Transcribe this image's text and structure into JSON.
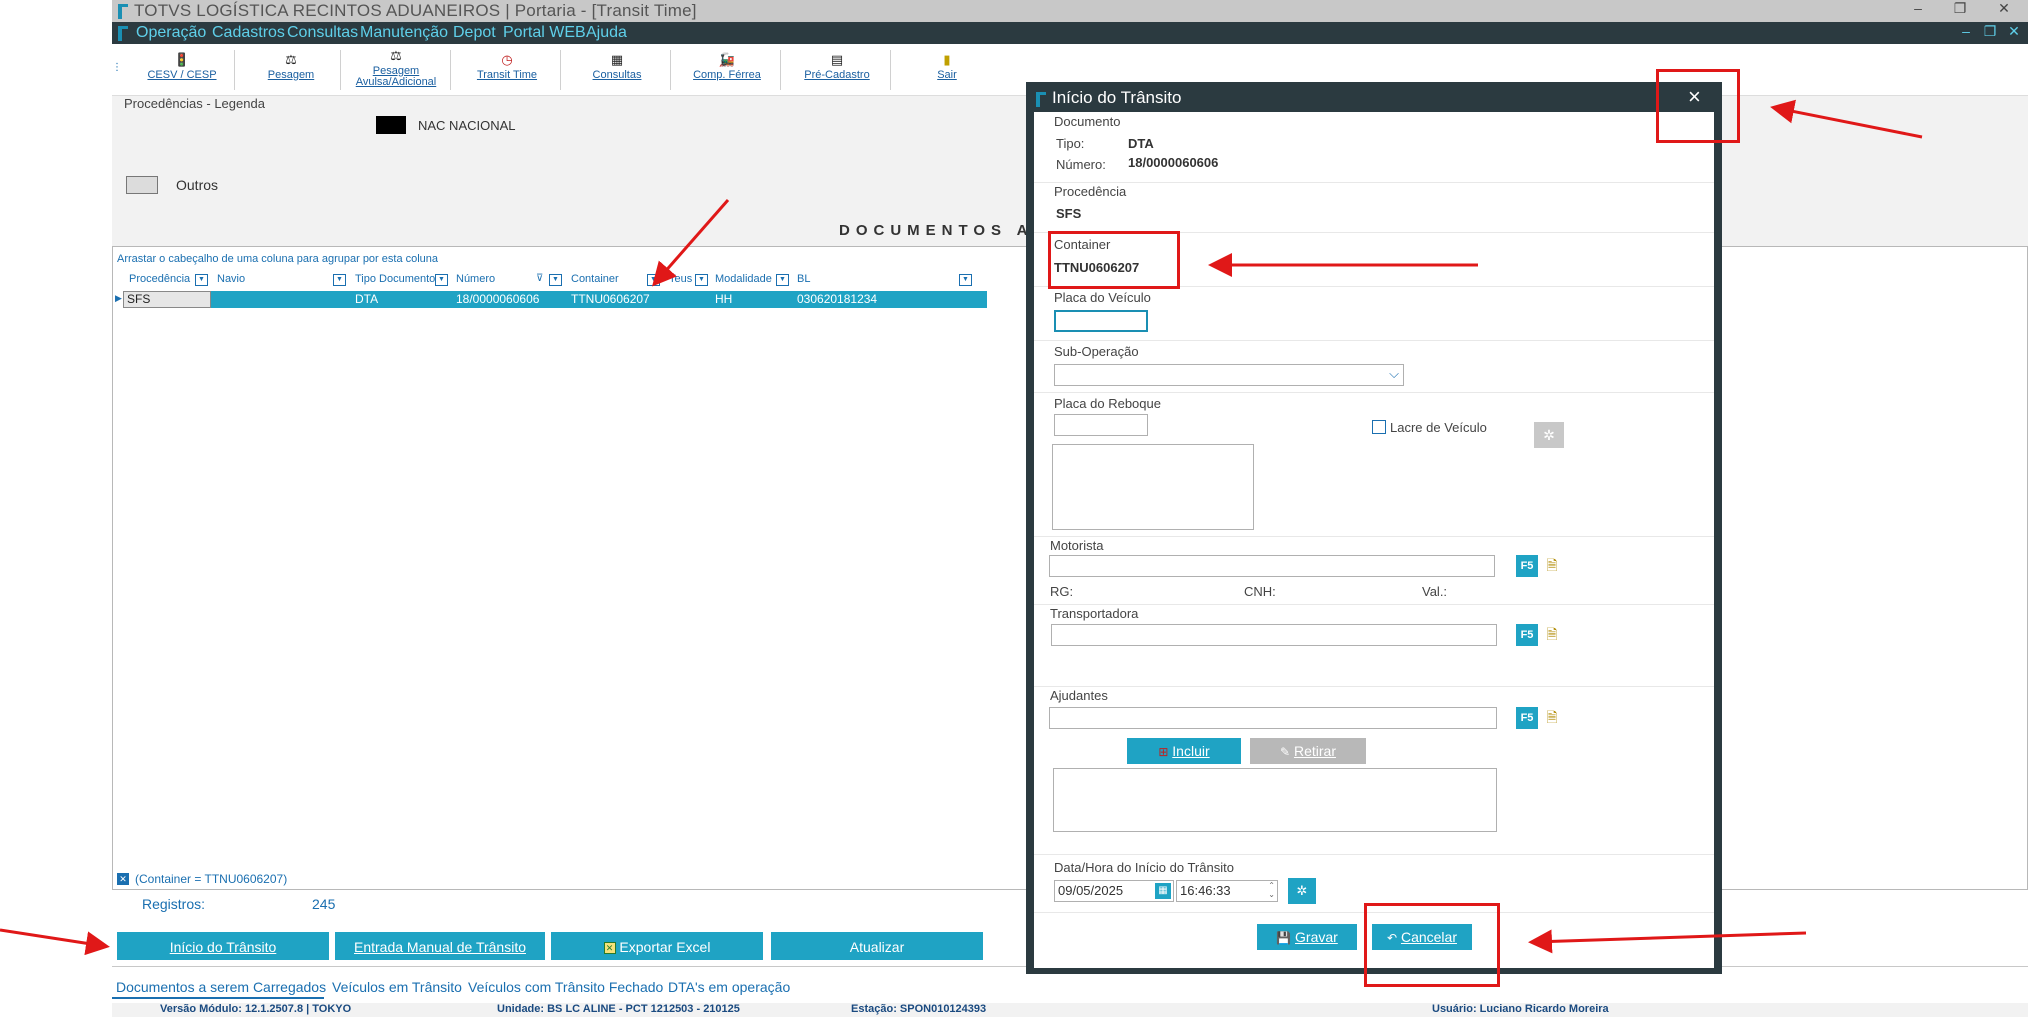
{
  "window": {
    "title": "TOTVS LOGÍSTICA RECINTOS ADUANEIROS | Portaria - [Transit Time]",
    "controls": [
      "–",
      "❐",
      "✕"
    ]
  },
  "menu": {
    "items": [
      "Operação",
      "Cadastros",
      "Consultas",
      "Manutenção",
      "Depot",
      "Portal WEB",
      "Ajuda"
    ],
    "controls": [
      "–",
      "❐",
      "✕"
    ]
  },
  "toolbar": {
    "items": [
      {
        "label": "CESV / CESP",
        "icon": "traffic-light-icon"
      },
      {
        "label": "Pesagem",
        "icon": "scale-icon"
      },
      {
        "label": "Pesagem Avulsa/Adicional",
        "icon": "scale-icon"
      },
      {
        "label": "Transit Time",
        "icon": "clock-icon"
      },
      {
        "label": "Consultas",
        "icon": "calculator-icon"
      },
      {
        "label": "Comp. Férrea",
        "icon": "train-icon"
      },
      {
        "label": "Pré-Cadastro",
        "icon": "register-icon"
      },
      {
        "label": "Sair",
        "icon": "exit-door-icon"
      }
    ]
  },
  "legend": {
    "title": "Procedências - Legenda",
    "nac": "NAC NACIONAL",
    "outros": "Outros"
  },
  "documents": {
    "title": "DOCUMENTOS A",
    "group_hint": "Arrastar o cabeçalho de uma coluna para agrupar por esta coluna",
    "columns": [
      "Procedência",
      "Navio",
      "Tipo Documento",
      "Número",
      "Container",
      "Teus",
      "Modalidade",
      "BL"
    ],
    "row": {
      "procedencia": "SFS",
      "tipo": "DTA",
      "numero": "18/0000060606",
      "container": "TTNU0606207",
      "modalidade": "HH",
      "bl": "030620181234"
    },
    "filter": "(Container = TTNU0606207)",
    "registros_label": "Registros:",
    "registros_value": "245"
  },
  "buttons": {
    "inicio": "Início do Trânsito",
    "entrada": "Entrada Manual de Trânsito",
    "exportar": "Exportar Excel",
    "atualizar": "Atualizar"
  },
  "tabs": [
    "Documentos a serem Carregados",
    "Veículos em Trânsito",
    "Veículos com Trânsito Fechado",
    "DTA's em operação"
  ],
  "status": {
    "versao": "Versão Módulo:  12.1.2507.8  |  TOKYO",
    "unidade": "Unidade: BS LC ALINE - PCT 1212503 - 210125",
    "estacao": "Estação: SPON010124393",
    "usuario": "Usuário: Luciano Ricardo Moreira"
  },
  "dialog": {
    "title": "Início do Trânsito",
    "close": "×",
    "documento_label": "Documento",
    "tipo_label": "Tipo:",
    "tipo_value": "DTA",
    "numero_label": "Número:",
    "numero_value": "18/0000060606",
    "procedencia_label": "Procedência",
    "procedencia_value": "SFS",
    "container_label": "Container",
    "container_value": "TTNU0606207",
    "placa_veiculo_label": "Placa do Veículo",
    "sub_operacao_label": "Sub-Operação",
    "placa_reboque_label": "Placa do Reboque",
    "lacre_label": "Lacre de Veículo",
    "motorista_label": "Motorista",
    "rg_label": "RG:",
    "cnh_label": "CNH:",
    "val_label": "Val.:",
    "transportadora_label": "Transportadora",
    "ajudantes_label": "Ajudantes",
    "incluir": "Incluir",
    "retirar": "Retirar",
    "f5": "F5",
    "datahora_label": "Data/Hora do Início do Trânsito",
    "data_value": "09/05/2025",
    "hora_value": "16:46:33",
    "gravar": "Gravar",
    "cancelar": "Cancelar"
  },
  "colors": {
    "accent": "#1fa3c4",
    "dark": "#2b3a40",
    "annotation": "#e01818"
  }
}
